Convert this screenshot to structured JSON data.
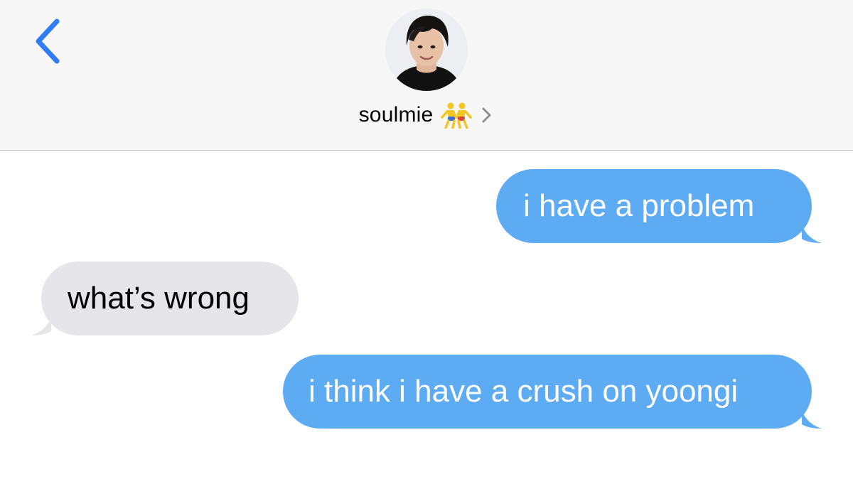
{
  "header": {
    "back_icon": "chevron-left-icon",
    "contact_name": "soulmie",
    "contact_emoji": "wrestlers-emoji",
    "disclosure_icon": "chevron-right-icon",
    "avatar": "contact-avatar-photo"
  },
  "colors": {
    "accent": "#2f7cf6",
    "sent_bubble": "#5dacf3",
    "received_bubble": "#e5e5ea",
    "header_bg": "#f7f7f7"
  },
  "messages": [
    {
      "direction": "sent",
      "text": "i have a problem"
    },
    {
      "direction": "received",
      "text": "what’s wrong"
    },
    {
      "direction": "sent",
      "text": "i think i have a crush on yoongi"
    }
  ]
}
